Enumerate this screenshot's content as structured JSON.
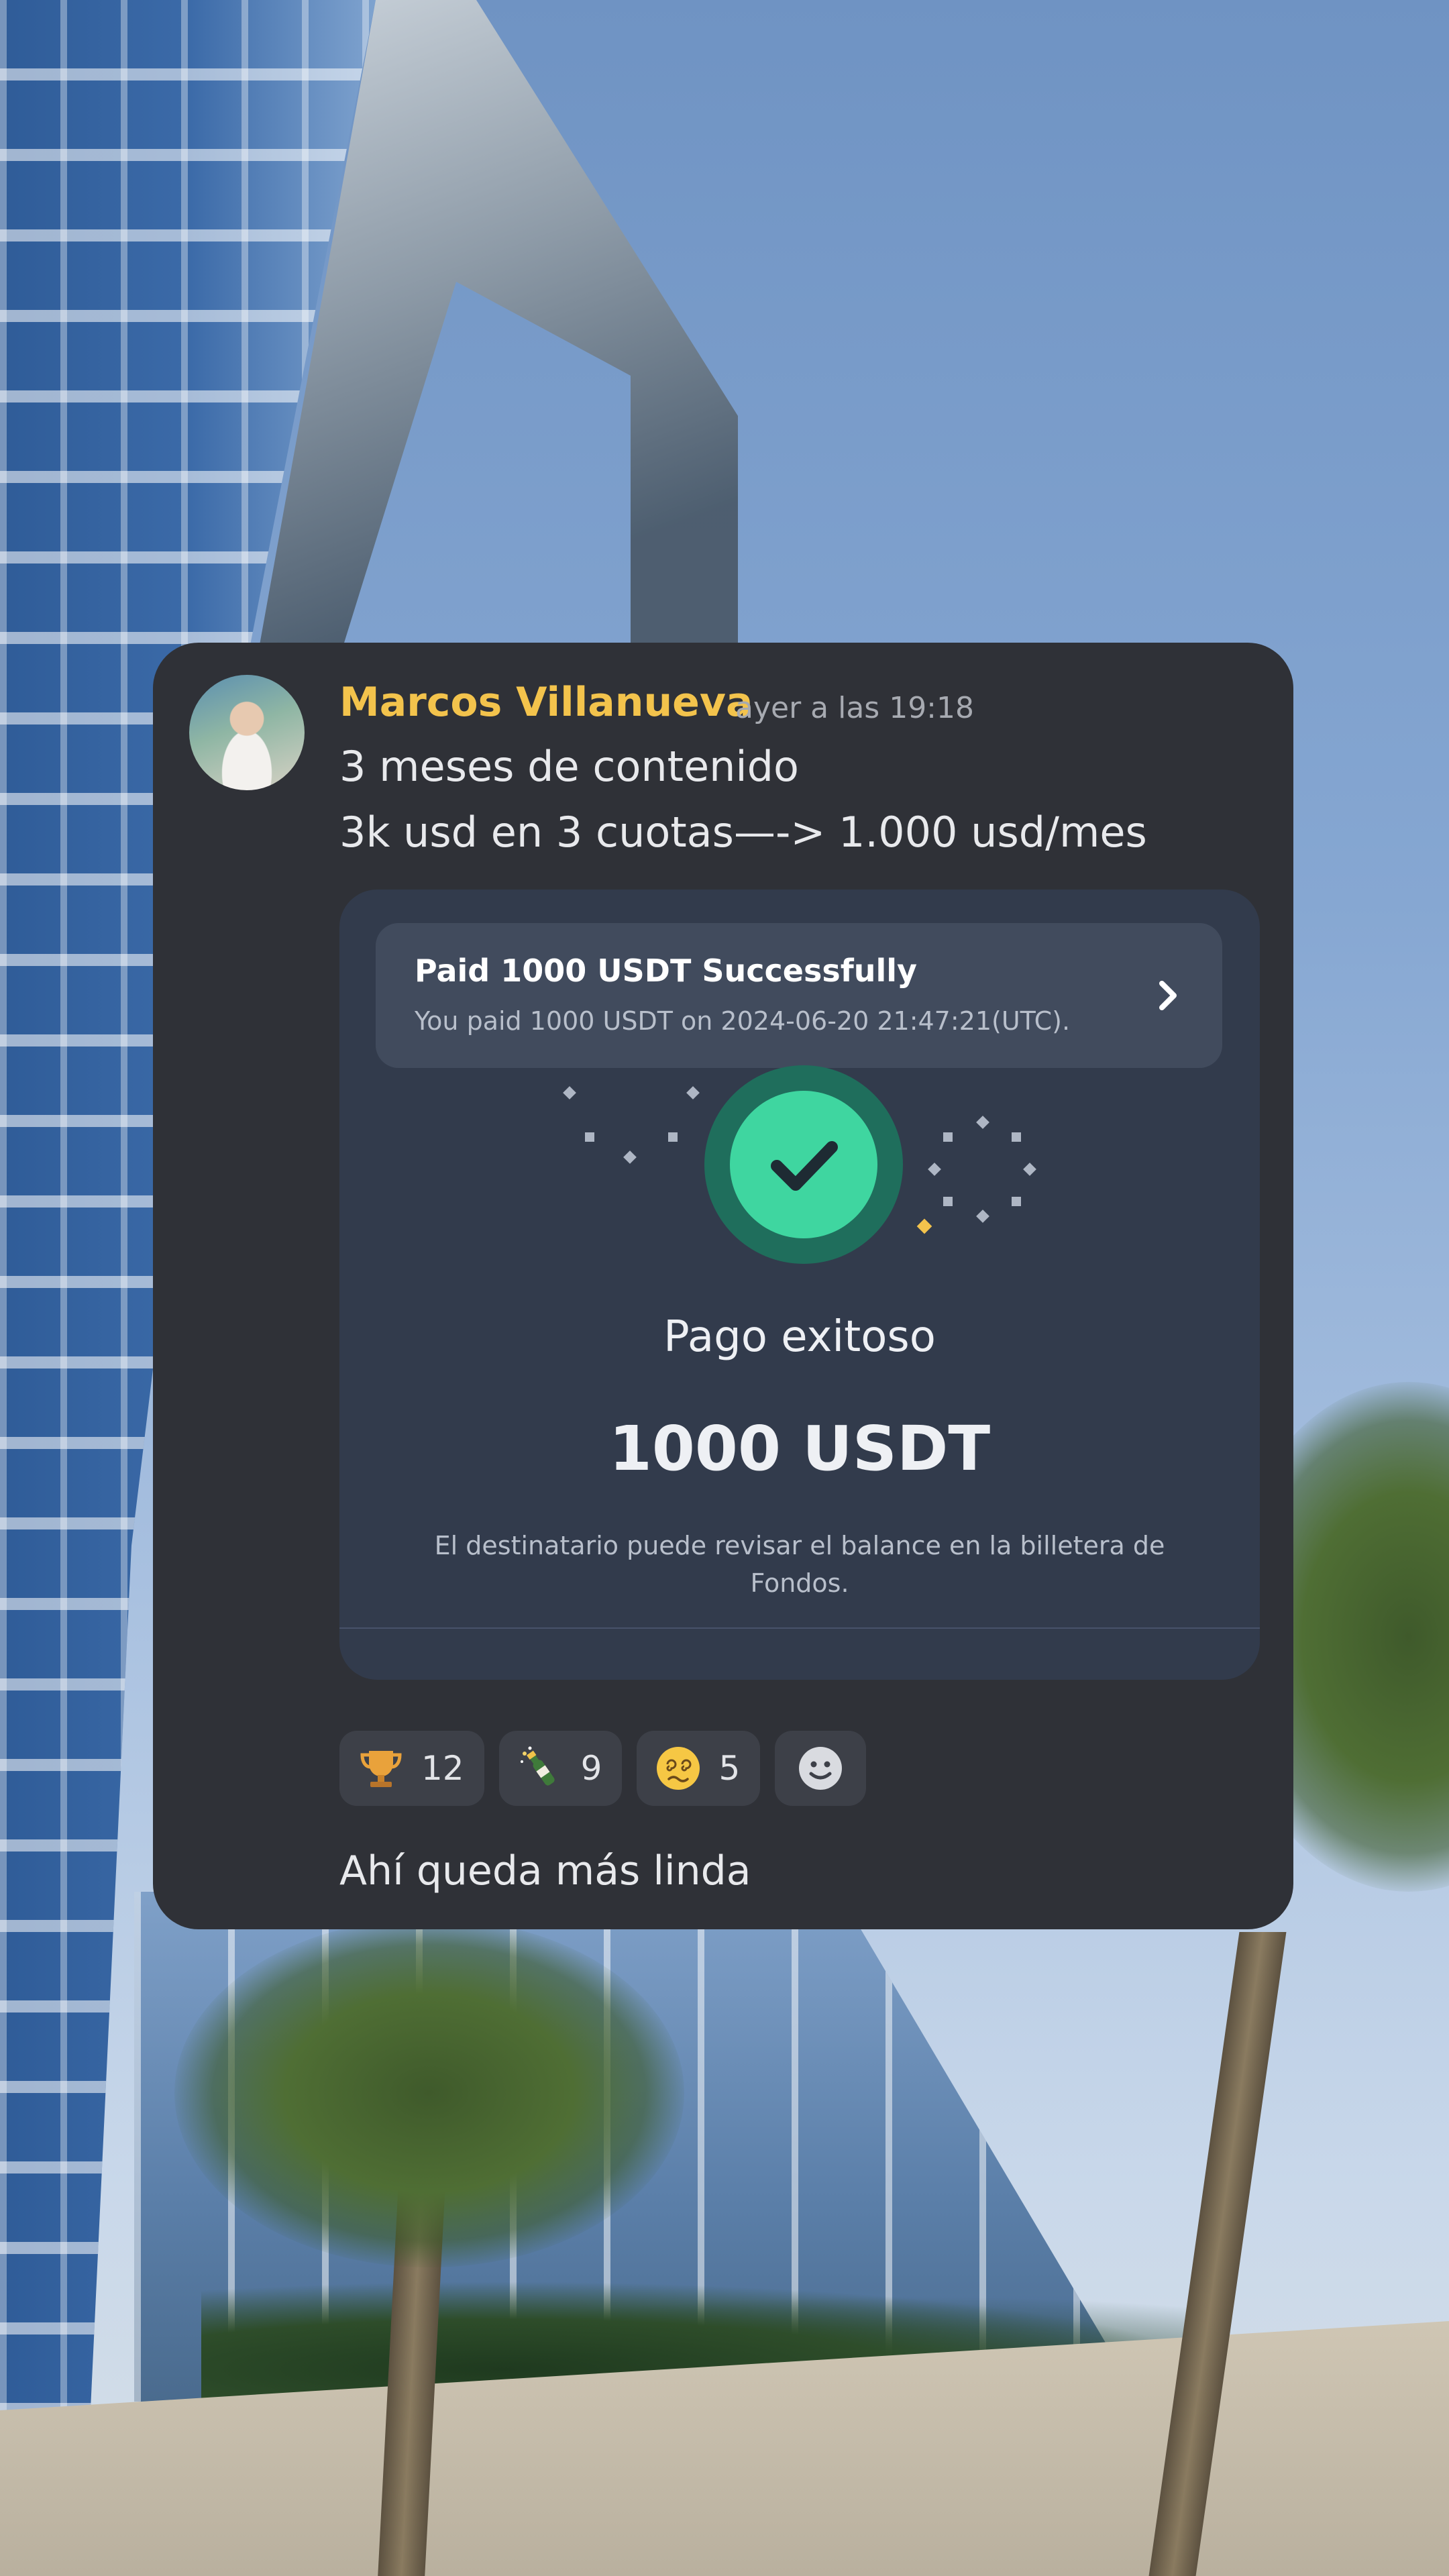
{
  "message": {
    "username": "Marcos Villanueva",
    "timestamp": "ayer a las 19:18",
    "lines": [
      "3 meses de contenido",
      "3k usd en 3 cuotas—-> 1.000 usd/mes"
    ],
    "avatar_icon": "user-photo-avatar"
  },
  "receipt": {
    "notice_title": "Paid 1000 USDT Successfully",
    "notice_subtitle": "You paid 1000 USDT on 2024-06-20 21:47:21(UTC).",
    "status_label": "Pago exitoso",
    "amount": "1000 USDT",
    "note": "El destinatario puede revisar el balance en la billetera de Fondos.",
    "success_color": "#3fd6a0"
  },
  "reactions": [
    {
      "icon": "trophy-icon",
      "count": "12"
    },
    {
      "icon": "champagne-icon",
      "count": "9"
    },
    {
      "icon": "dizzy-face-icon",
      "count": "5"
    },
    {
      "icon": "add-reaction-smiley-icon",
      "count": ""
    }
  ],
  "reply": "Ahí queda más linda",
  "colors": {
    "card_bg": "#2f3137",
    "username": "#f3c34c",
    "embed_bg": "#323b4c"
  }
}
